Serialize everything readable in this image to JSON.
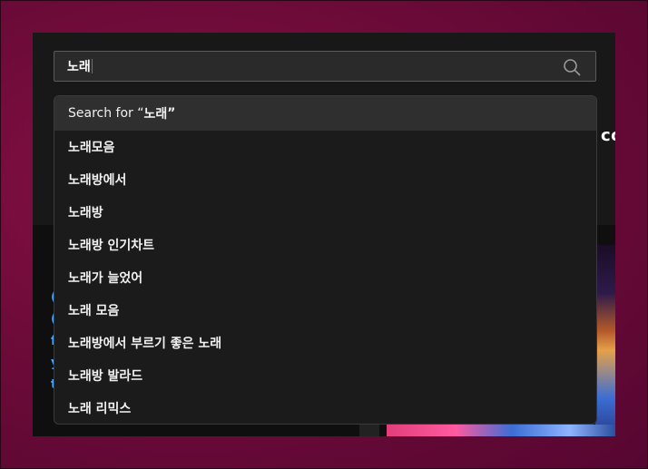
{
  "search": {
    "query": "노래",
    "submit_icon": "search-icon"
  },
  "suggestions": {
    "search_for_prefix": "Search for “",
    "search_for_suffix": "”",
    "items": [
      "노래모음",
      "노래방에서",
      "노래방",
      "노래방 인기차트",
      "노래가 늘었어",
      "노래 모음",
      "노래방에서 부르기 좋은 노래",
      "노래방 발라드",
      "노래 리믹스"
    ]
  },
  "background": {
    "peek_heading": "co"
  },
  "colors": {
    "page_bg": "#6e0b39",
    "window_bg": "#0f0f0f",
    "panel_bg": "#1b1b1b",
    "highlight_row": "#2f2f2f",
    "caret": "#e04030"
  }
}
